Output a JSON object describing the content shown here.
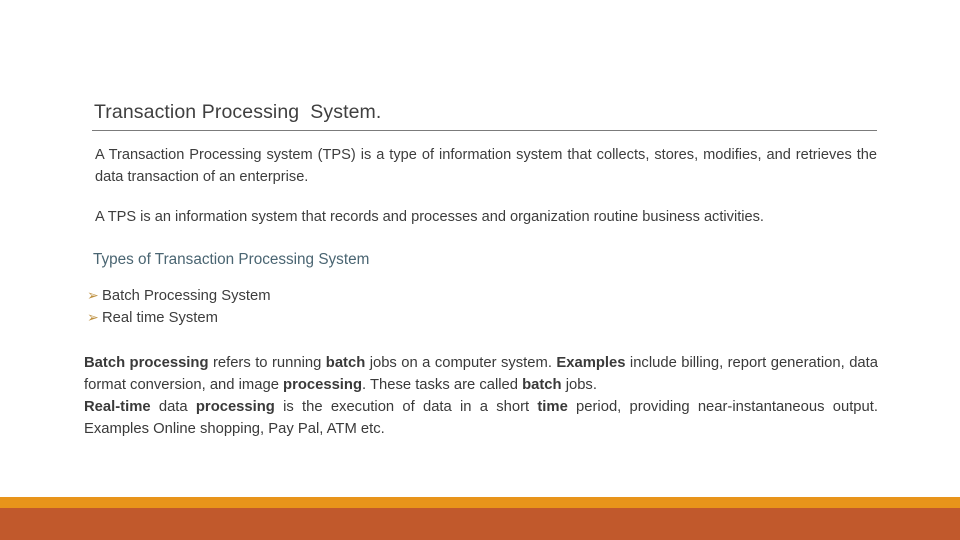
{
  "slide": {
    "title": "Transaction Processing  System.",
    "paragraph_1": "A Transaction Processing system (TPS) is a type of information system that collects, stores, modifies, and retrieves the data transaction of an enterprise.",
    "paragraph_2": "A TPS is an information system that records and processes and organization routine business activities.",
    "subheading": "Types of Transaction Processing System",
    "bullet_glyph": "➢",
    "bullets": [
      {
        "label": "Batch Processing System"
      },
      {
        "label": "Real time System"
      }
    ],
    "closing": {
      "batch_bold_1": "Batch processing",
      "batch_text_1": " refers to running ",
      "batch_bold_2": "batch",
      "batch_text_2": " jobs on a computer system. ",
      "batch_bold_3": "Examples",
      "batch_text_3": " include billing, report generation, data format conversion, and image ",
      "batch_bold_4": "processing",
      "batch_text_4": ". These tasks are called ",
      "batch_bold_5": "batch",
      "batch_text_5": " jobs.",
      "realtime_bold_1": "Real-time",
      "realtime_text_1": " data ",
      "realtime_bold_2": "processing",
      "realtime_text_2": " is the execution of data in a short ",
      "realtime_bold_3": "time",
      "realtime_text_3": " period, providing near-instantaneous output. Examples Online shopping, Pay Pal, ATM etc."
    }
  },
  "colors": {
    "title_text": "#3f3f3f",
    "body_text": "#3d3d3d",
    "subheading": "#4a6572",
    "bullet_marker": "#bf9141",
    "footer_stripe": "#e8941a",
    "footer_band": "#c1592c",
    "rule": "#7b7b7b"
  }
}
